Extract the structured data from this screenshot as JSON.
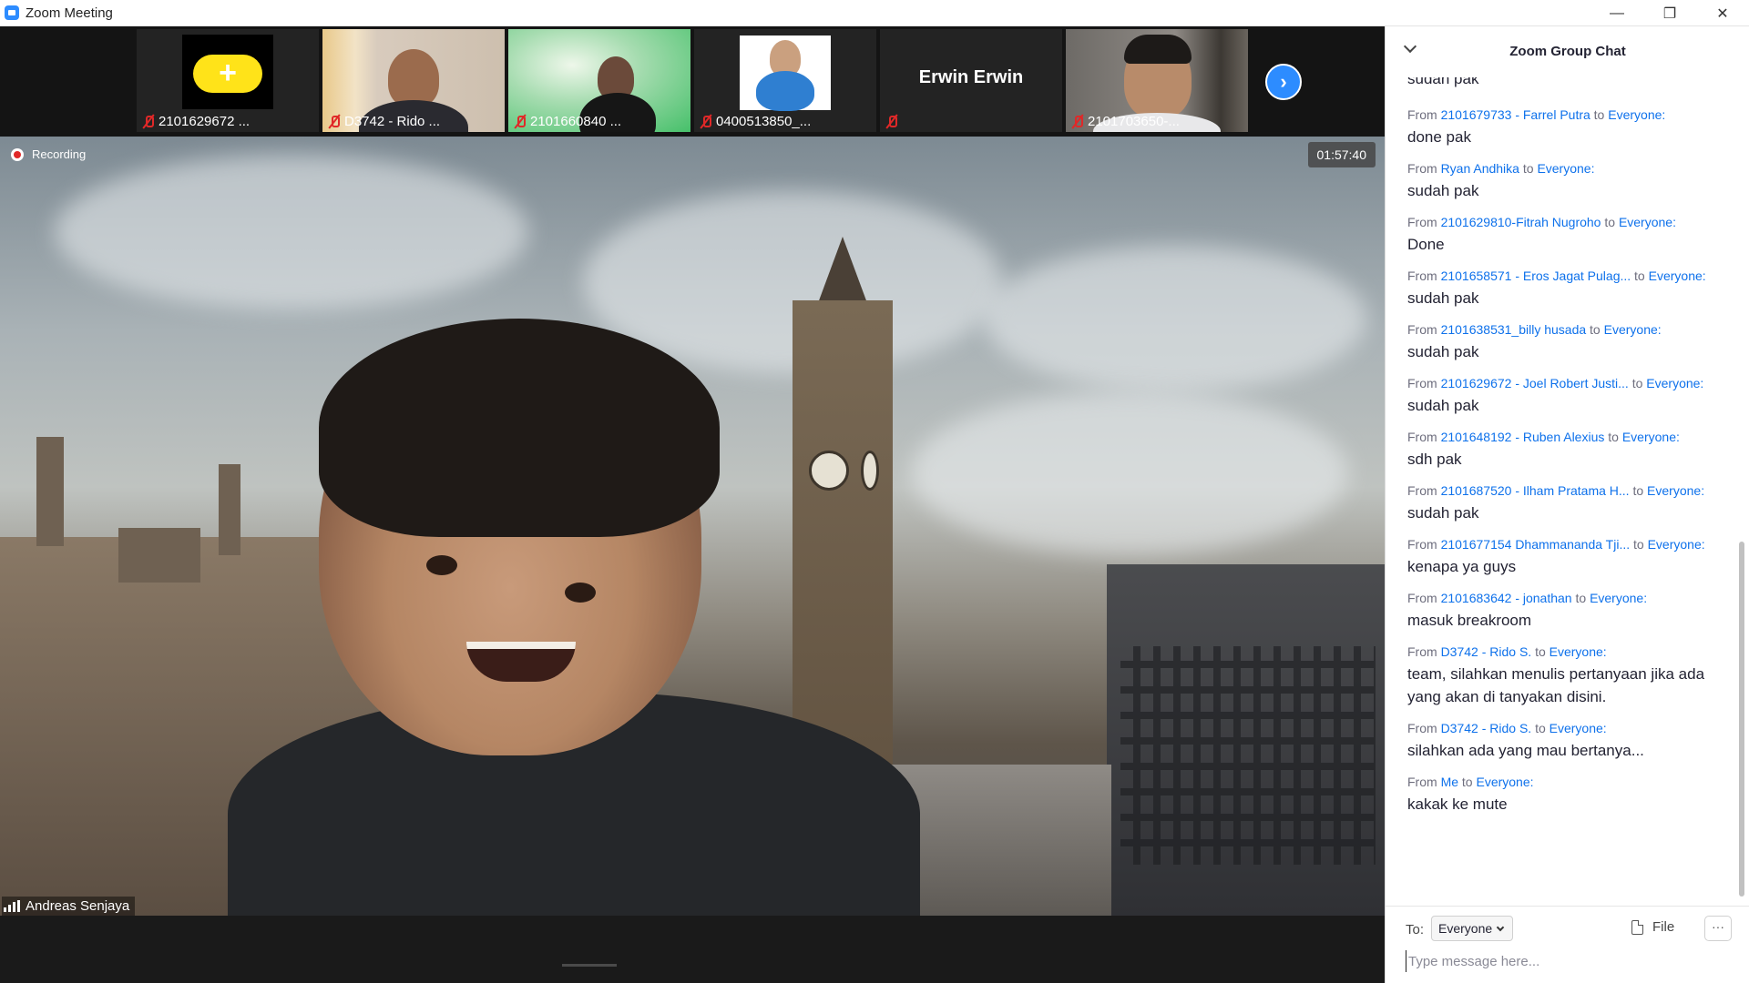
{
  "window": {
    "title": "Zoom Meeting",
    "controls": {
      "minimize": "—",
      "maximize": "❐",
      "close": "✕"
    }
  },
  "gallery": {
    "participants": [
      {
        "label": "2101629672 ...",
        "muted": true,
        "kind": "avatar-yellow",
        "avatar_glyph": "+"
      },
      {
        "label": "D3742 - Rido ...",
        "muted": true,
        "kind": "video"
      },
      {
        "label": "2101660840 ...",
        "muted": true,
        "kind": "video"
      },
      {
        "label": "0400513850_...",
        "muted": true,
        "kind": "photo"
      },
      {
        "label": "Erwin Erwin",
        "muted": true,
        "kind": "name-only"
      },
      {
        "label": "2101703650-...",
        "muted": true,
        "kind": "video"
      }
    ],
    "next_icon": "chevron-right-icon",
    "next_glyph": "›"
  },
  "main_video": {
    "recording_label": "Recording",
    "timer": "01:57:40",
    "speaker_name": "Andreas Senjaya"
  },
  "chat": {
    "title": "Zoom Group Chat",
    "partial_top": "sudah pak",
    "messages": [
      {
        "from_prefix": "From",
        "sender": "2101679733 - Farrel Putra",
        "to_prefix": "to",
        "recipient": "Everyone:",
        "text": "done pak"
      },
      {
        "from_prefix": "From",
        "sender": "Ryan Andhika",
        "to_prefix": "to",
        "recipient": "Everyone:",
        "text": "sudah pak"
      },
      {
        "from_prefix": "From",
        "sender": "2101629810-Fitrah Nugroho",
        "to_prefix": "to",
        "recipient": "Everyone:",
        "text": "Done"
      },
      {
        "from_prefix": "From",
        "sender": "2101658571 - Eros Jagat Pulag...",
        "to_prefix": "to",
        "recipient": "Everyone:",
        "text": "sudah pak"
      },
      {
        "from_prefix": "From",
        "sender": "2101638531_billy husada",
        "to_prefix": "to",
        "recipient": "Everyone:",
        "text": "sudah pak"
      },
      {
        "from_prefix": "From",
        "sender": "2101629672 - Joel Robert Justi...",
        "to_prefix": "to",
        "recipient": "Everyone:",
        "text": "sudah pak"
      },
      {
        "from_prefix": "From",
        "sender": "2101648192 - Ruben Alexius",
        "to_prefix": "to",
        "recipient": "Everyone:",
        "text": "sdh pak"
      },
      {
        "from_prefix": "From",
        "sender": "2101687520 - Ilham Pratama H...",
        "to_prefix": "to",
        "recipient": "Everyone:",
        "text": "sudah pak"
      },
      {
        "from_prefix": "From",
        "sender": "2101677154 Dhammananda Tji...",
        "to_prefix": "to",
        "recipient": "Everyone:",
        "text": "kenapa ya guys"
      },
      {
        "from_prefix": "From",
        "sender": "2101683642 - jonathan",
        "to_prefix": "to",
        "recipient": "Everyone:",
        "text": "masuk breakroom"
      },
      {
        "from_prefix": "From",
        "sender": "D3742 - Rido S.",
        "to_prefix": "to",
        "recipient": "Everyone:",
        "text": "team, silahkan menulis pertanyaan jika ada yang akan di tanyakan disini."
      },
      {
        "from_prefix": "From",
        "sender": "D3742 - Rido S.",
        "to_prefix": "to",
        "recipient": "Everyone:",
        "text": "silahkan ada yang mau bertanya..."
      },
      {
        "from_prefix": "From",
        "sender": "Me",
        "to_prefix": "to",
        "recipient": "Everyone:",
        "text": "kakak ke mute"
      }
    ],
    "footer": {
      "to_label": "To:",
      "to_value": "Everyone",
      "file_label": "File",
      "more_label": "···",
      "input_placeholder": "Type message here...",
      "input_value": ""
    }
  },
  "colors": {
    "accent": "#0e71eb",
    "brand": "#2d8cff",
    "muted_red": "#e02828",
    "chat_bg": "#ffffff",
    "video_bg": "#1a1a1a"
  }
}
